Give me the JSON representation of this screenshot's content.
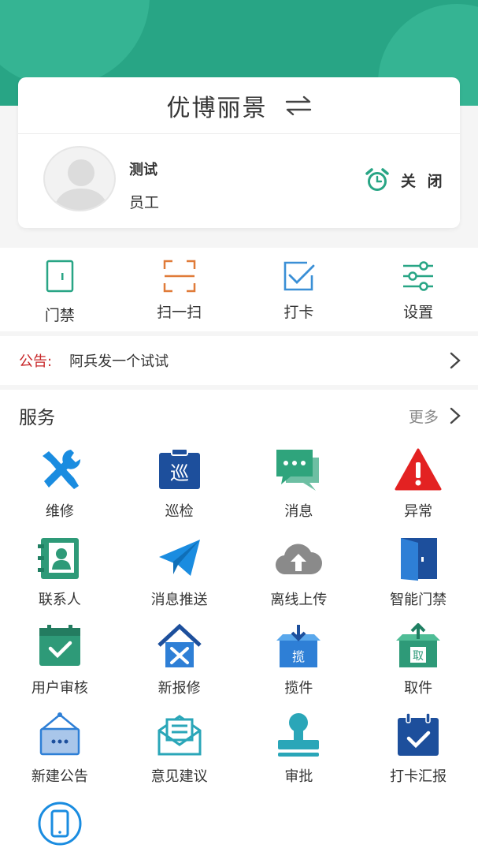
{
  "header": {
    "title": "优博丽景",
    "swap_icon": "swap-arrows-icon",
    "bg_color": "#28a585"
  },
  "user": {
    "name": "测试",
    "role": "员工",
    "alarm_label": "关 闭",
    "alarm_color": "#28a585"
  },
  "quick_actions": [
    {
      "label": "门禁",
      "icon": "door-icon",
      "color": "#28a585"
    },
    {
      "label": "扫一扫",
      "icon": "scan-icon",
      "color": "#e07b39"
    },
    {
      "label": "打卡",
      "icon": "checkin-icon",
      "color": "#3a8fd6"
    },
    {
      "label": "设置",
      "icon": "settings-sliders-icon",
      "color": "#28a585"
    }
  ],
  "notice": {
    "key": "公告:",
    "text": "阿兵发一个试试"
  },
  "services": {
    "title": "服务",
    "more_label": "更多",
    "items": [
      {
        "label": "维修",
        "icon": "repair-tools-icon"
      },
      {
        "label": "巡检",
        "icon": "inspection-icon"
      },
      {
        "label": "消息",
        "icon": "message-icon"
      },
      {
        "label": "异常",
        "icon": "warning-icon"
      },
      {
        "label": "联系人",
        "icon": "contacts-icon"
      },
      {
        "label": "消息推送",
        "icon": "paper-plane-icon"
      },
      {
        "label": "离线上传",
        "icon": "cloud-upload-icon"
      },
      {
        "label": "智能门禁",
        "icon": "smart-door-icon"
      },
      {
        "label": "用户审核",
        "icon": "user-review-icon"
      },
      {
        "label": "新报修",
        "icon": "new-repair-icon"
      },
      {
        "label": "揽件",
        "icon": "package-collect-icon",
        "badge": "揽"
      },
      {
        "label": "取件",
        "icon": "package-pickup-icon",
        "badge": "取"
      },
      {
        "label": "新建公告",
        "icon": "announcement-icon"
      },
      {
        "label": "意见建议",
        "icon": "feedback-mail-icon"
      },
      {
        "label": "审批",
        "icon": "approval-stamp-icon"
      },
      {
        "label": "打卡汇报",
        "icon": "checkin-report-icon"
      },
      {
        "label": "",
        "icon": "mobile-phone-icon"
      }
    ]
  }
}
